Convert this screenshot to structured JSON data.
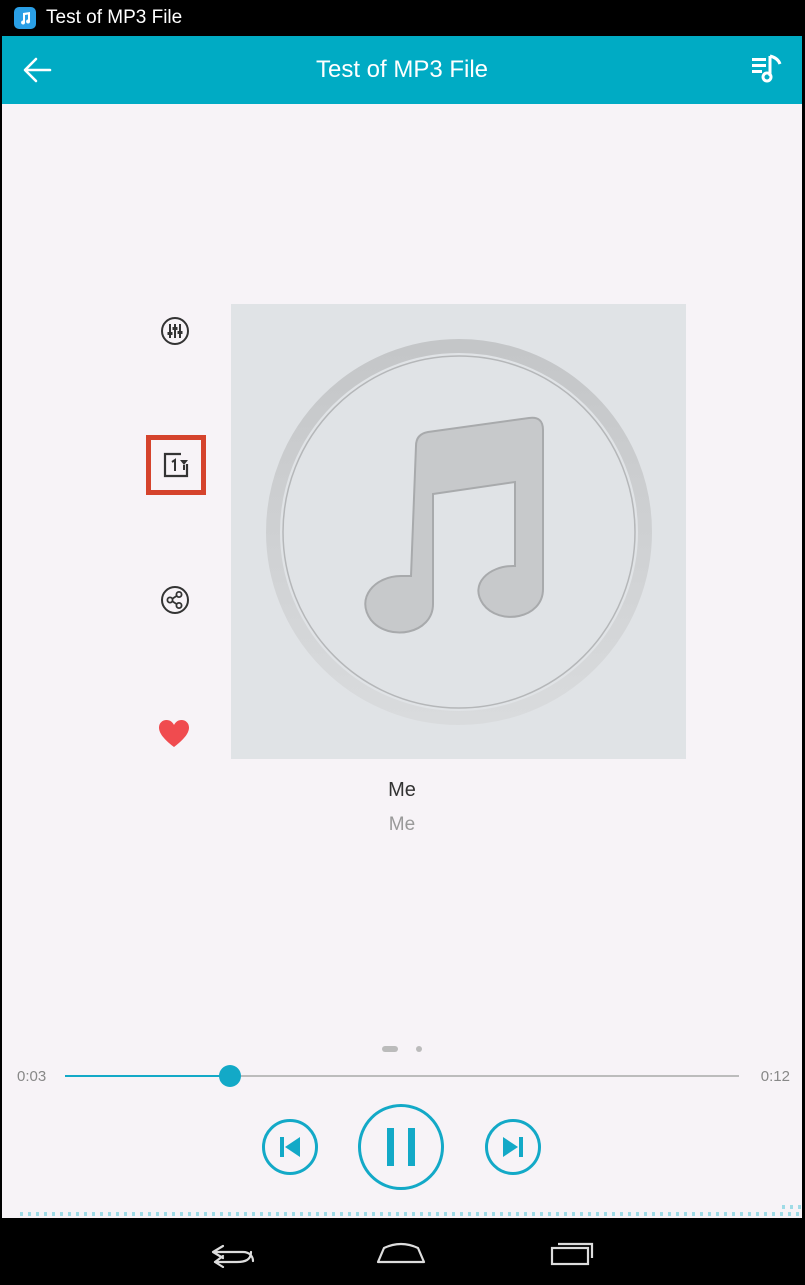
{
  "status_bar": {
    "app_title": "Test of MP3 File",
    "app_icon": "music-note-icon"
  },
  "app_bar": {
    "title": "Test of MP3 File",
    "back_icon": "arrow-back-icon",
    "queue_icon": "playlist-music-icon"
  },
  "side_actions": [
    {
      "name": "equalizer",
      "icon": "equalizer-icon"
    },
    {
      "name": "add-to-playlist",
      "icon": "add-to-playlist-icon",
      "highlighted": true
    },
    {
      "name": "share",
      "icon": "share-icon"
    },
    {
      "name": "favorite",
      "icon": "heart-icon"
    }
  ],
  "song": {
    "title": "Me",
    "artist": "Me"
  },
  "player": {
    "current_time": "0:03",
    "duration": "0:12",
    "progress": 0.245
  },
  "controls": {
    "prev_icon": "skip-previous-icon",
    "pause_icon": "pause-icon",
    "next_icon": "skip-next-icon"
  },
  "colors": {
    "accent": "#00abc4",
    "favorite": "#f04b4f",
    "highlight": "#d5432c",
    "background": "#f7f3f7"
  },
  "nav_bar": {
    "back_icon": "nav-back-icon",
    "home_icon": "nav-home-icon",
    "recents_icon": "nav-recents-icon"
  }
}
